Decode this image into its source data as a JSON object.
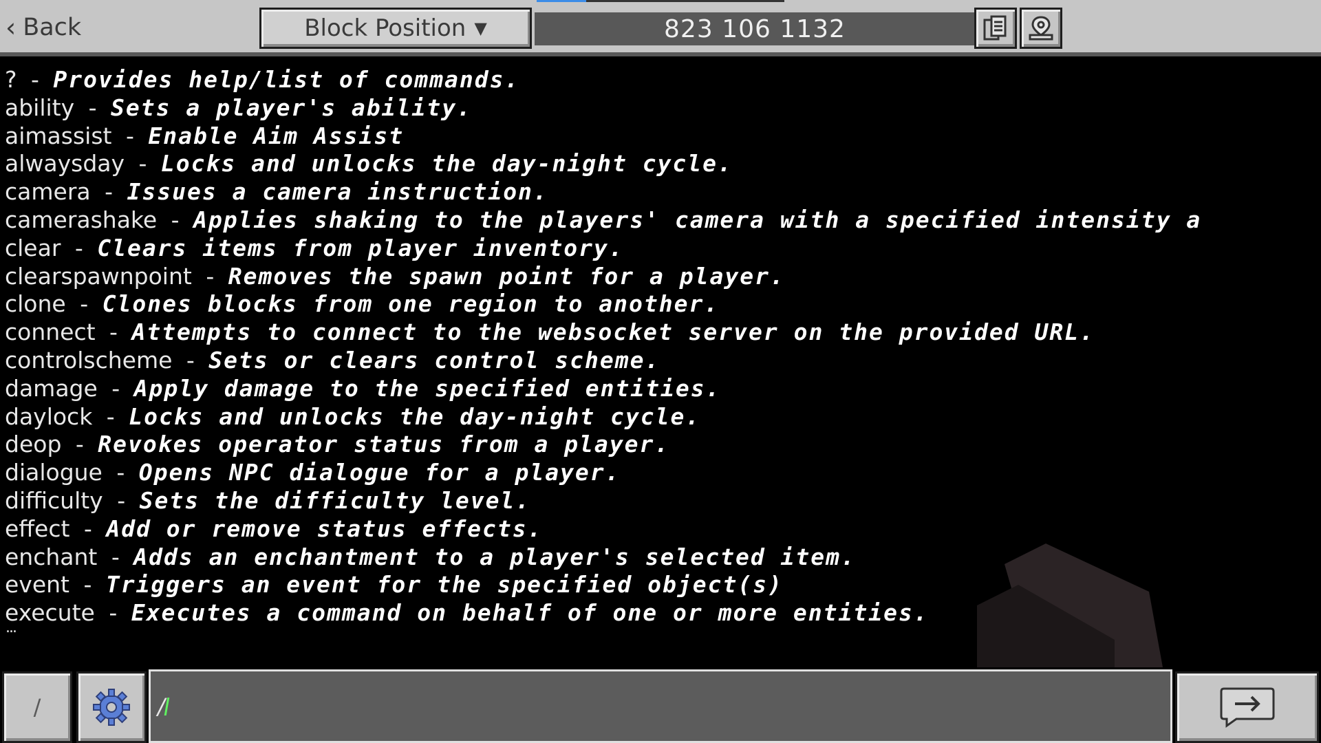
{
  "header": {
    "back_label": "Back",
    "dropdown_label": "Block Position",
    "coordinates": "823 106 1132"
  },
  "chat": {
    "lines": [
      {
        "cmd": "?",
        "desc": "Provides help/list of commands."
      },
      {
        "cmd": "ability",
        "desc": "Sets a player's ability."
      },
      {
        "cmd": "aimassist",
        "desc": "Enable Aim Assist"
      },
      {
        "cmd": "alwaysday",
        "desc": "Locks and unlocks the day-night cycle."
      },
      {
        "cmd": "camera",
        "desc": "Issues a camera instruction."
      },
      {
        "cmd": "camerashake",
        "desc": "Applies shaking to the players' camera with a specified intensity a"
      },
      {
        "cmd": "clear",
        "desc": "Clears items from player inventory."
      },
      {
        "cmd": "clearspawnpoint",
        "desc": "Removes the spawn point for a player."
      },
      {
        "cmd": "clone",
        "desc": "Clones blocks from one region to another."
      },
      {
        "cmd": "connect",
        "desc": "Attempts to connect to the websocket server on the provided URL."
      },
      {
        "cmd": "controlscheme",
        "desc": "Sets or clears control scheme."
      },
      {
        "cmd": "damage",
        "desc": "Apply damage to the specified entities."
      },
      {
        "cmd": "daylock",
        "desc": "Locks and unlocks the day-night cycle."
      },
      {
        "cmd": "deop",
        "desc": "Revokes operator status from a player."
      },
      {
        "cmd": "dialogue",
        "desc": "Opens NPC dialogue for a player."
      },
      {
        "cmd": "difficulty",
        "desc": "Sets the difficulty level."
      },
      {
        "cmd": "effect",
        "desc": "Add or remove status effects."
      },
      {
        "cmd": "enchant",
        "desc": "Adds an enchantment to a player's selected item."
      },
      {
        "cmd": "event",
        "desc": "Triggers an event for the specified object(s)"
      },
      {
        "cmd": "execute",
        "desc": "Executes a command on behalf of one or more entities."
      }
    ],
    "separator": "-",
    "ellipsis": "..."
  },
  "input": {
    "slash_label": "/",
    "value": "/"
  },
  "colors": {
    "background": "#000000",
    "panel": "#c6c6c6",
    "input_bg": "#5c5c5c",
    "cursor": "#5ff25f",
    "tab_active": "#3c8ce7",
    "gear": "#5b7fd6"
  }
}
